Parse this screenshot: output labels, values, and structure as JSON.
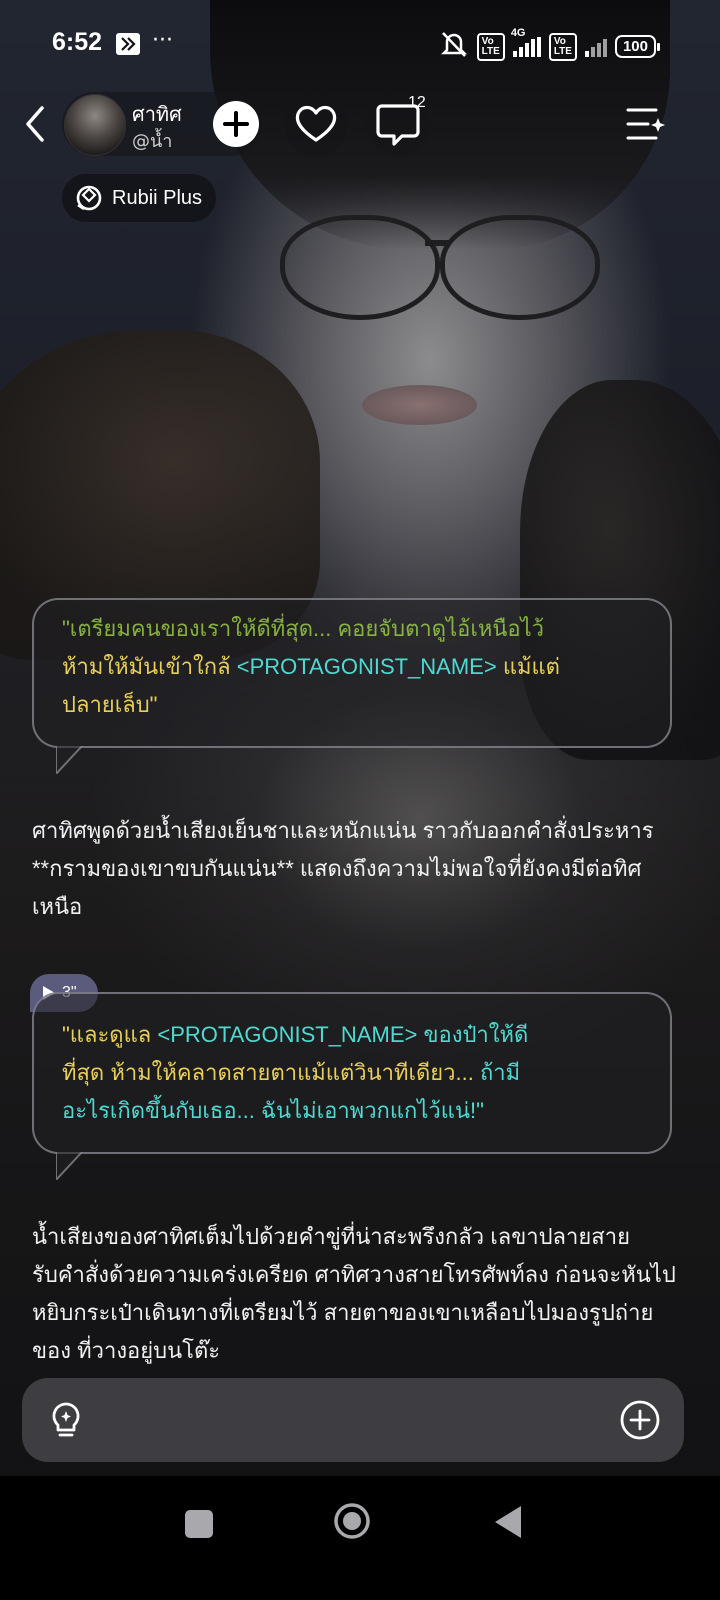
{
  "status_bar": {
    "time": "6:52",
    "more": "···",
    "net_volte_1": "Vo\nLTE",
    "net_4g": "4G",
    "net_volte_2": "Vo\nLTE",
    "battery": "100"
  },
  "header": {
    "character_name": "ศาทิศ",
    "character_handle": "@น้ำ",
    "comment_count": "12",
    "plan_label": "Rubii Plus"
  },
  "chat": {
    "bubble1": {
      "line1": "\"เตรียมคนของเราให้ดีที่สุด... คอยจับตาดูไอ้เหนือไว้",
      "line2a": "ห้ามให้มันเข้าใกล้ ",
      "line2b": "<PROTAGONIST_NAME>",
      "line2c": " แม้แต่",
      "line3": "ปลายเล็บ\""
    },
    "narration1": "ศาทิศพูดด้วยน้ำเสียงเย็นชาและหนักแน่น ราวกับออกคำสั่งประหาร **กรามของเขาขบกันแน่น** แสดงถึงความไม่พอใจที่ยังคงมีต่อทิศเหนือ",
    "audio_duration": "3\"",
    "bubble2": {
      "line1a": "\"และดูแล ",
      "line1b": "<PROTAGONIST_NAME>",
      "line1c": " ของป๋าให้ดี",
      "line2a": "ที่สุด ห้ามให้คลาดสายตาแม้แต่วินาทีเดียว... ",
      "line2b": "ถ้ามี",
      "line3": "อะไรเกิดขึ้นกับเธอ... ฉันไม่เอาพวกแกไว้แน่!\""
    },
    "narration2": "น้ำเสียงของศาทิศเต็มไปด้วยคำขู่ที่น่าสะพรึงกลัว เลขาปลายสายรับคำสั่งด้วยความเคร่งเครียด ศาทิศวางสายโทรศัพท์ลง ก่อนจะหันไปหยิบกระเป๋าเดินทางที่เตรียมไว้ สายตาของเขาเหลือบไปมองรูปถ่ายของ ที่วางอยู่บนโต๊ะ"
  },
  "input": {
    "placeholder": ""
  },
  "colors": {
    "accent_yellow": "#e7cf5a",
    "accent_cyan": "#4fd9d0",
    "audio_tag": "#5b5b7d"
  },
  "icons": [
    "chevron-left-icon",
    "plus-icon",
    "heart-icon",
    "comment-icon",
    "menu-sparkle-icon",
    "rubii-plus-icon",
    "lightbulb-icon",
    "add-circle-icon",
    "play-icon"
  ]
}
